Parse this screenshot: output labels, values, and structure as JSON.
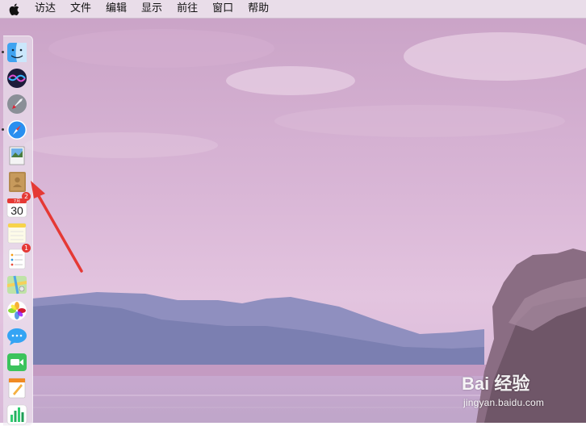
{
  "menubar": {
    "apple_icon": "apple-logo-icon",
    "items": [
      {
        "label": "访达"
      },
      {
        "label": "文件"
      },
      {
        "label": "编辑"
      },
      {
        "label": "显示"
      },
      {
        "label": "前往"
      },
      {
        "label": "窗口"
      },
      {
        "label": "帮助"
      }
    ]
  },
  "dock": {
    "items": [
      {
        "name": "finder",
        "running": true
      },
      {
        "name": "siri",
        "running": false
      },
      {
        "name": "launchpad",
        "running": false
      },
      {
        "name": "safari",
        "running": true
      },
      {
        "name": "mail",
        "running": false
      },
      {
        "name": "contacts",
        "running": false
      },
      {
        "name": "calendar",
        "running": false,
        "badge": "2",
        "day": "30",
        "month": "7月"
      },
      {
        "name": "notes",
        "running": false
      },
      {
        "name": "reminders",
        "running": false,
        "badge": "1"
      },
      {
        "name": "maps",
        "running": false
      },
      {
        "name": "photos",
        "running": false
      },
      {
        "name": "messages",
        "running": false
      },
      {
        "name": "facetime",
        "running": false
      },
      {
        "name": "pages",
        "running": false
      },
      {
        "name": "numbers",
        "running": false
      }
    ]
  },
  "annotation": {
    "arrow_color": "#e53935",
    "points_to": "contacts"
  },
  "watermark": {
    "logo": "Bai 经验",
    "url": "jingyan.baidu.com"
  },
  "colors": {
    "sky": "#d7b3d4",
    "mountain": "#7b80b0",
    "menubar": "#ece2ec"
  }
}
